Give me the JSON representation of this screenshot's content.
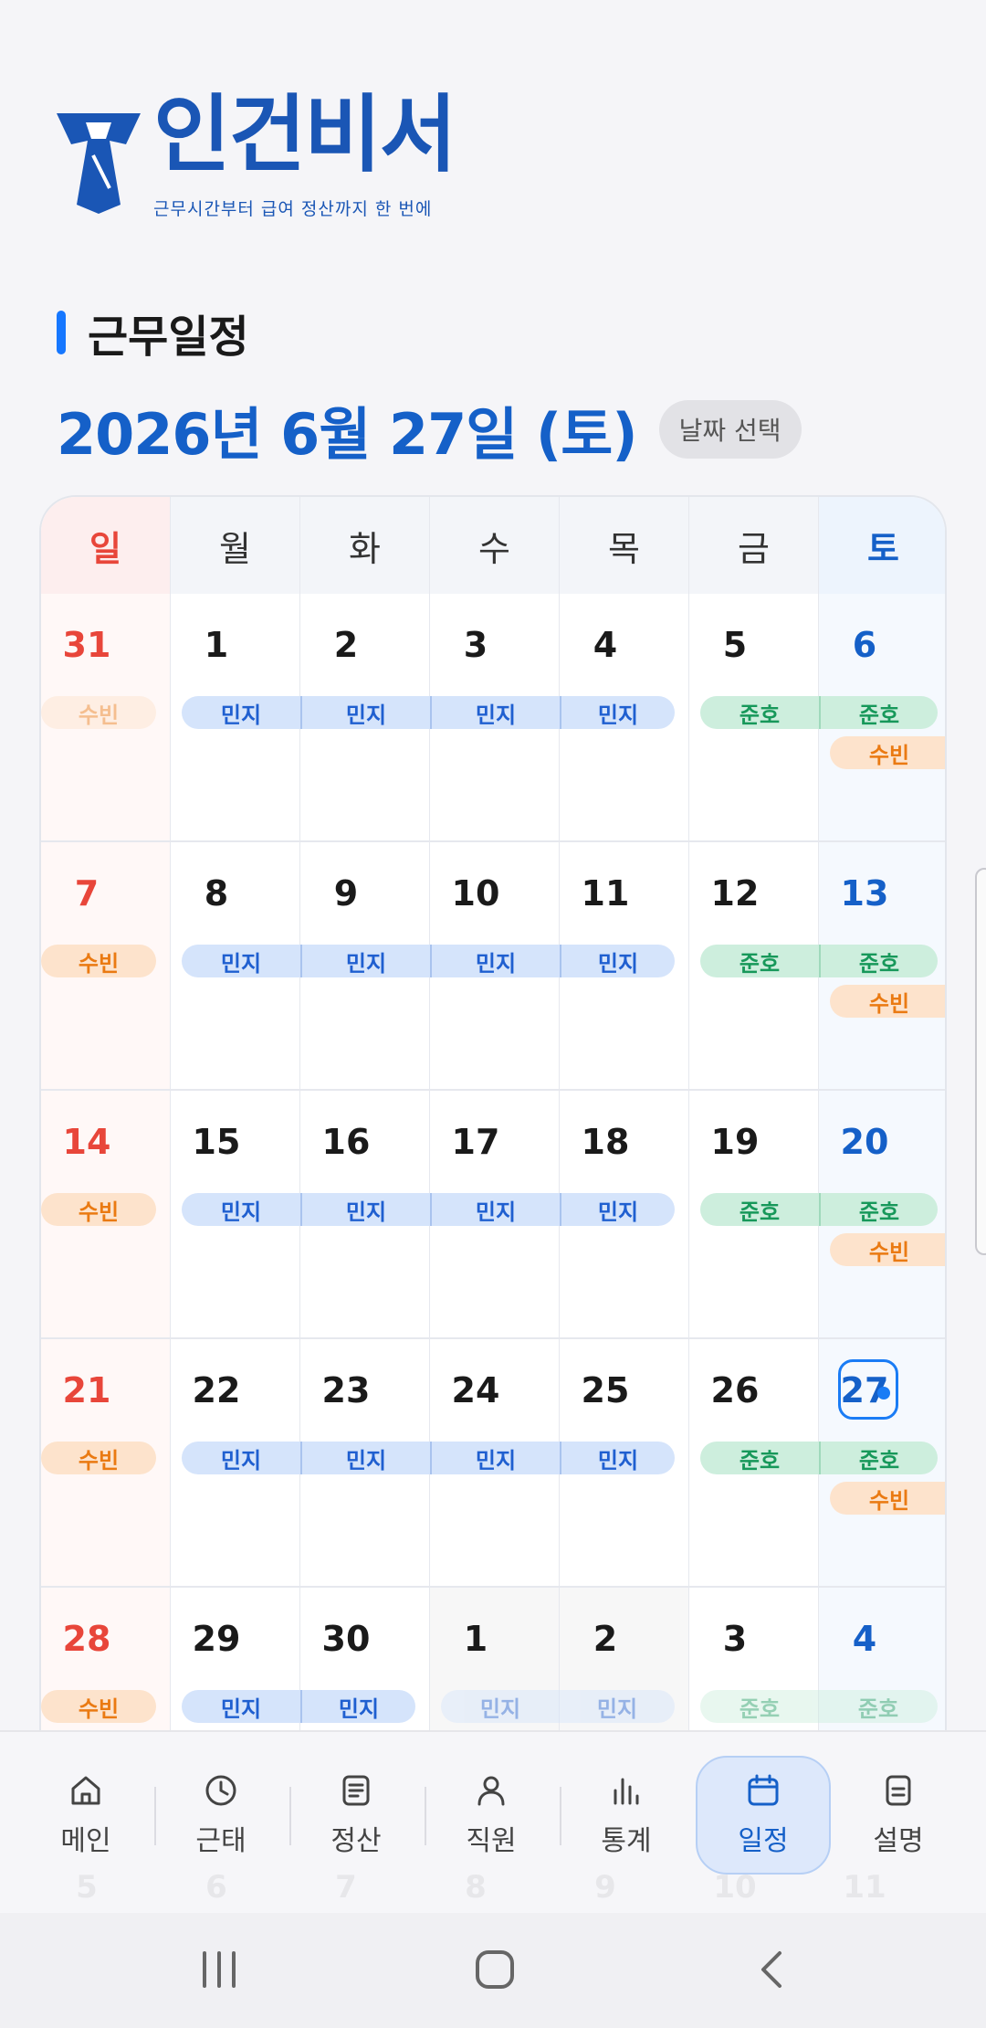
{
  "app": {
    "name": "인건비서",
    "tagline": "근무시간부터 급여 정산까지 한 번에"
  },
  "section_title": "근무일정",
  "current_date": "2026년 6월 27일 (토)",
  "date_picker_label": "날짜 선택",
  "weekdays": [
    "일",
    "월",
    "화",
    "수",
    "목",
    "금",
    "토"
  ],
  "weeks": [
    [
      "31",
      "1",
      "2",
      "3",
      "4",
      "5",
      "6"
    ],
    [
      "7",
      "8",
      "9",
      "10",
      "11",
      "12",
      "13"
    ],
    [
      "14",
      "15",
      "16",
      "17",
      "18",
      "19",
      "20"
    ],
    [
      "21",
      "22",
      "23",
      "24",
      "25",
      "26",
      "27"
    ],
    [
      "28",
      "29",
      "30",
      "1",
      "2",
      "3",
      "4"
    ]
  ],
  "ghost_row": [
    "5",
    "6",
    "7",
    "8",
    "9",
    "10",
    "11"
  ],
  "today": "27",
  "staff": {
    "minji": "민지",
    "junho": "준호",
    "subin": "수빈"
  },
  "nav": [
    {
      "label": "메인",
      "icon": "home-icon"
    },
    {
      "label": "근태",
      "icon": "clock-icon"
    },
    {
      "label": "정산",
      "icon": "document-icon"
    },
    {
      "label": "직원",
      "icon": "person-icon"
    },
    {
      "label": "통계",
      "icon": "bar-chart-icon"
    },
    {
      "label": "일정",
      "icon": "calendar-icon",
      "active": true
    },
    {
      "label": "설명",
      "icon": "notes-icon"
    }
  ],
  "colors": {
    "brand": "#1a56b5",
    "accent": "#1677ff",
    "sunday": "#e8463a",
    "saturday": "#1560c8",
    "minji": "#d5e4fb",
    "junho": "#cdeedd",
    "subin": "#fde3cc"
  }
}
